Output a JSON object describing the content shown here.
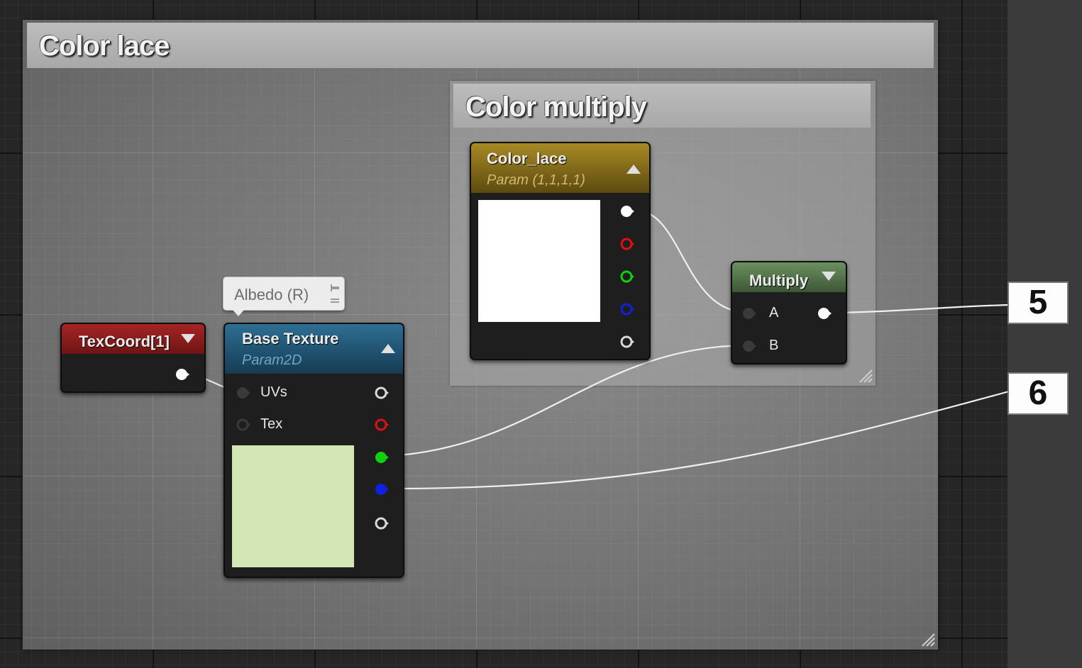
{
  "comments": {
    "outer_title": "Color lace",
    "inner_title": "Color multiply"
  },
  "nodes": {
    "texcoord": {
      "title": "TexCoord[1]",
      "header_color": "#8c1f1f"
    },
    "base_texture": {
      "title": "Base Texture",
      "subtitle": "Param2D",
      "header_color": "#1f5f80",
      "inputs": [
        "UVs",
        "Tex"
      ],
      "preview_color": "#d4e6b6",
      "comment_bubble": "Albedo (R)"
    },
    "color_lace": {
      "title": "Color_lace",
      "subtitle": "Param (1,1,1,1)",
      "header_color": "#8a6f1a",
      "preview_color": "#ffffff"
    },
    "multiply": {
      "title": "Multiply",
      "header_color": "#5a7c52",
      "inputs": [
        "A",
        "B"
      ]
    }
  },
  "pin_colors": {
    "rgb": "#ffffff",
    "r": "#e01010",
    "g": "#10d010",
    "b": "#1020e0",
    "a": "#d8d8d8"
  },
  "callouts": [
    "5",
    "6"
  ]
}
